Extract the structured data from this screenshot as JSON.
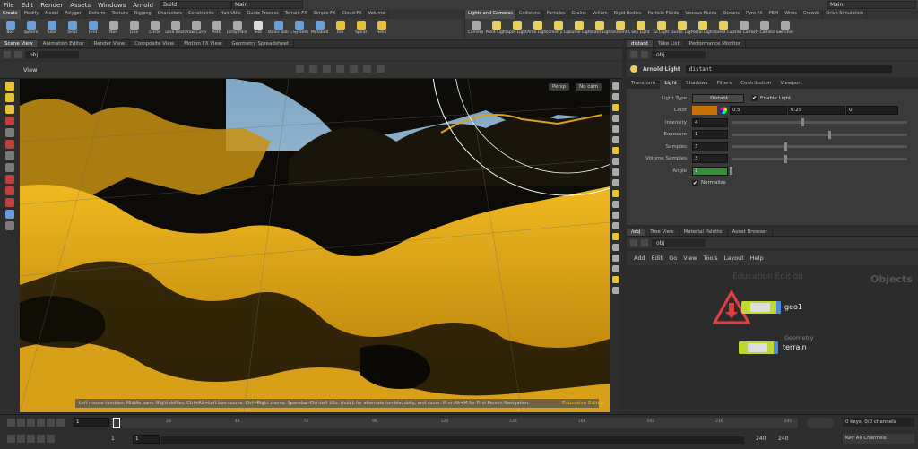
{
  "menu": [
    "File",
    "Edit",
    "Render",
    "Assets",
    "Windows",
    "Arnold",
    "Help"
  ],
  "desktop_left": "Build",
  "desktop_right": "Main",
  "desktop_center": "Main",
  "shelf_tabs_left": [
    "Create",
    "Modify",
    "Model",
    "Polygon",
    "Deform",
    "Texture",
    "Rigging",
    "Characters",
    "Constraints",
    "Hair Utils",
    "Guide Process",
    "Terrain FX",
    "Simple FX",
    "Cloud FX",
    "Volume"
  ],
  "shelf_tabs_right": [
    "Lights and Cameras",
    "Collisions",
    "Particles",
    "Grains",
    "Vellum",
    "Rigid Bodies",
    "Particle Fluids",
    "Viscous Fluids",
    "Oceans",
    "Pyro FX",
    "FEM",
    "Wires",
    "Crowds",
    "Drive Simulation"
  ],
  "tools_left": [
    {
      "l": "Box",
      "c": "#6aa0d8"
    },
    {
      "l": "Sphere",
      "c": "#6aa0d8"
    },
    {
      "l": "Tube",
      "c": "#6aa0d8"
    },
    {
      "l": "Torus",
      "c": "#6aa0d8"
    },
    {
      "l": "Grid",
      "c": "#6aa0d8"
    },
    {
      "l": "Null",
      "c": "#aaa"
    },
    {
      "l": "Line",
      "c": "#aaa"
    },
    {
      "l": "Circle",
      "c": "#aaa"
    },
    {
      "l": "Curve Bezier",
      "c": "#aaa"
    },
    {
      "l": "Draw Curve",
      "c": "#aaa"
    },
    {
      "l": "Path",
      "c": "#aaa"
    },
    {
      "l": "Spray Paint",
      "c": "#aaa"
    },
    {
      "l": "Text",
      "c": "#ddd"
    },
    {
      "l": "Platonic Solids",
      "c": "#6aa0d8"
    },
    {
      "l": "L-System",
      "c": "#6aa0d8"
    },
    {
      "l": "Metaball",
      "c": "#6aa0d8"
    },
    {
      "l": "File",
      "c": "#e8c040"
    },
    {
      "l": "Spiral",
      "c": "#e8c040"
    },
    {
      "l": "Helix",
      "c": "#e8c040"
    }
  ],
  "tools_right": [
    {
      "l": "Camera",
      "c": "#aaa"
    },
    {
      "l": "Point Light",
      "c": "#e8d060"
    },
    {
      "l": "Spot Light",
      "c": "#e8d060"
    },
    {
      "l": "Area Light",
      "c": "#e8d060"
    },
    {
      "l": "Geometry Light",
      "c": "#e8d060"
    },
    {
      "l": "Volume Light",
      "c": "#e8d060"
    },
    {
      "l": "Distant Light",
      "c": "#e8d060"
    },
    {
      "l": "Environment Light",
      "c": "#e8d060"
    },
    {
      "l": "Sky Light",
      "c": "#e8d060"
    },
    {
      "l": "GI Light",
      "c": "#e8d060"
    },
    {
      "l": "Caustic Light",
      "c": "#e8d060"
    },
    {
      "l": "Portal Light",
      "c": "#e8d060"
    },
    {
      "l": "Ambient Light",
      "c": "#e8d060"
    },
    {
      "l": "Stereo Camera",
      "c": "#aaa"
    },
    {
      "l": "VR Camera",
      "c": "#aaa"
    },
    {
      "l": "Switcher",
      "c": "#aaa"
    }
  ],
  "pane_tabs_left": [
    "Scene View",
    "Animation Editor",
    "Render View",
    "Composite View",
    "Motion FX View",
    "Geometry Spreadsheet"
  ],
  "pane_tabs_right": [
    "distant",
    "Take List",
    "Performance Monitor"
  ],
  "path_left": "obj",
  "path_right": "obj",
  "viewport": {
    "title": "View",
    "persp": "Persp",
    "cam": "No cam",
    "status": "Left mouse tumbles. Middle pans. Right dollies. Ctrl+Alt+Left box-zooms. Ctrl+Right zooms. Spacebar-Ctrl-Left tilts. Hold L for alternate tumble, dolly, and zoom.    M or Alt+M for First Person Navigation.",
    "edition": "Education Edition"
  },
  "params": {
    "node_type": "Arnold Light",
    "node_name": "distant",
    "tabs": [
      "Transform",
      "Light",
      "Shadows",
      "Filters",
      "Contribution",
      "Viewport"
    ],
    "light_type_label": "Light Type",
    "light_type": "Distant",
    "enable_label": "Enable Light",
    "color_label": "Color",
    "color": [
      "0.5",
      "0.25",
      "0"
    ],
    "color_swatch": "#c87000",
    "rows": [
      {
        "label": "Intensity",
        "value": "4",
        "pos": 0.4
      },
      {
        "label": "Exposure",
        "value": "1",
        "pos": 0.55
      },
      {
        "label": "Samples",
        "value": "3",
        "pos": 0.3
      },
      {
        "label": "Volume Samples",
        "value": "3",
        "pos": 0.3
      }
    ],
    "angle_label": "Angle",
    "angle": "1",
    "normalize_label": "Normalize"
  },
  "net_tabs": [
    "/obj",
    "Tree View",
    "Material Palette",
    "Asset Browser"
  ],
  "net_menu": [
    "Add",
    "Edit",
    "Go",
    "View",
    "Tools",
    "Layout",
    "Help"
  ],
  "net": {
    "watermark": "Education Edition",
    "context": "Objects",
    "node1": "geo1",
    "node2": "terrain",
    "node2_type": "Geometry"
  },
  "timeline": {
    "frame": "1",
    "ticks": [
      "24",
      "48",
      "72",
      "96",
      "120",
      "144",
      "168",
      "192",
      "216",
      "240"
    ],
    "start": "1",
    "start2": "1",
    "end": "240",
    "end2": "240",
    "keys": "0 keys, 0/0 channels",
    "keyall": "Key All Channels"
  }
}
